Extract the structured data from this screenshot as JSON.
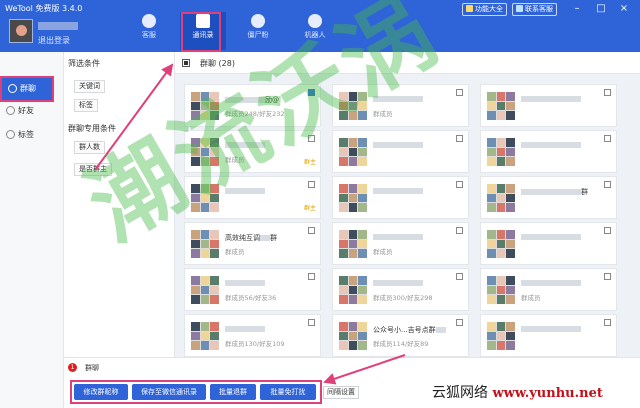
{
  "app": {
    "title": "WeTool 免费版 3.4.0"
  },
  "account": {
    "logout": "退出登录"
  },
  "toolbar": {
    "feature_btn": "功能大全",
    "support_btn": "联系客服"
  },
  "window_controls": {
    "minimize": "–",
    "close": "×"
  },
  "nav": [
    {
      "label": "客服"
    },
    {
      "label": "通讯录",
      "active": true
    },
    {
      "label": "僵尸粉"
    },
    {
      "label": "机器人"
    }
  ],
  "sidebar": [
    {
      "label": "群聊",
      "active": true
    },
    {
      "label": "好友"
    },
    {
      "label": "标签"
    }
  ],
  "filter": {
    "title": "筛选条件",
    "keyword": "关键词",
    "tag": "标签",
    "group_title": "群聊专用条件",
    "member_count": "群人数",
    "is_owner": "是否群主"
  },
  "main": {
    "group_label": "群聊",
    "group_count": "(28)"
  },
  "cards": [
    {
      "name": "",
      "meta": "群成员248/好友232",
      "tail": "励@",
      "checked": true
    },
    {
      "name": "",
      "meta": "群成员",
      "tail": "",
      "checked": false
    },
    {
      "name": "",
      "meta": "",
      "tail": "",
      "checked": false
    },
    {
      "name": "",
      "meta": "群成员",
      "tail": "",
      "checked": false,
      "tag": "群主"
    },
    {
      "name": "",
      "meta": "",
      "tail": "",
      "checked": false
    },
    {
      "name": "",
      "meta": "",
      "tail": "",
      "checked": false
    },
    {
      "name": "",
      "meta": "",
      "tail": "",
      "checked": false,
      "tag": "群主"
    },
    {
      "name": "",
      "meta": "",
      "tail": "",
      "checked": false
    },
    {
      "name": "",
      "meta": "",
      "tail": "群",
      "checked": false
    },
    {
      "name": "高效纯互调",
      "meta": "群成员",
      "tail": "群",
      "checked": false
    },
    {
      "name": "",
      "meta": "群成员",
      "tail": "",
      "checked": false
    },
    {
      "name": "",
      "meta": "",
      "tail": "",
      "checked": false
    },
    {
      "name": "",
      "meta": "群成员56/好友36",
      "tail": "",
      "checked": false
    },
    {
      "name": "",
      "meta": "群成员300/好友298",
      "tail": "",
      "checked": false
    },
    {
      "name": "",
      "meta": "群成员",
      "tail": "",
      "checked": false
    },
    {
      "name": "",
      "meta": "群成员130/好友109",
      "tail": "",
      "checked": false
    },
    {
      "name": "公众号小...吉号点群",
      "meta": "群成员114/好友89",
      "tail": "",
      "checked": false
    },
    {
      "name": "",
      "meta": "",
      "tail": "",
      "checked": false
    }
  ],
  "bottom": {
    "selected_count": "1",
    "selected_label": "群聊",
    "actions": [
      "修改群昵称",
      "保存至微信通讯录",
      "批量退群",
      "批量免打扰"
    ],
    "interval": "间隔设置"
  },
  "watermark": {
    "text": "潮流沃涡"
  },
  "site_mark": {
    "text": "云狐网络",
    "url": "www.yunhu.net"
  },
  "colors": {
    "primary": "#2f64d8",
    "highlight": "#e0407a",
    "watermark": "#46b946"
  }
}
